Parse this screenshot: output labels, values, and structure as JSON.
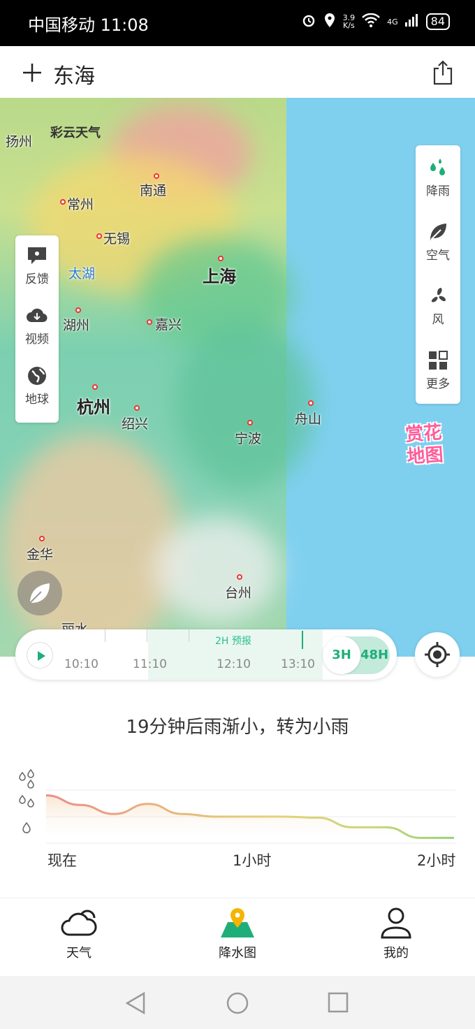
{
  "status_bar": {
    "carrier_time": "中国移动 11:08",
    "net_speed_value": "3.9",
    "net_speed_unit": "K/s",
    "network": "4G",
    "battery": "84"
  },
  "header": {
    "city": "东海"
  },
  "map": {
    "logo": "彩云天气",
    "cities": {
      "yangzhou": "扬州",
      "nantong": "南通",
      "changzhou": "常州",
      "wuxi": "无锡",
      "taihu": "太湖",
      "shanghai": "上海",
      "huzhou": "湖州",
      "jiaxing": "嘉兴",
      "hangzhou": "杭州",
      "shaoxing": "绍兴",
      "ningbo": "宁波",
      "zhoushan": "舟山",
      "jinhua": "金华",
      "taizhou": "台州",
      "lishui": "丽水"
    },
    "left_panel": {
      "feedback": "反馈",
      "video": "视频",
      "globe": "地球"
    },
    "right_panel": {
      "rain": "降雨",
      "air": "空气",
      "wind": "风",
      "more": "更多"
    },
    "flower_badge": {
      "line1": "赏花",
      "line2": "地图"
    }
  },
  "timeline": {
    "forecast_label": "2H 预报",
    "times": [
      "10:10",
      "11:10",
      "12:10",
      "13:10"
    ],
    "range_3h": "3H",
    "range_48h": "48H",
    "selected_range": "3H"
  },
  "summary": "19分钟后雨渐小，转为小雨",
  "chart_data": {
    "type": "area",
    "title": "",
    "x_labels": [
      "现在",
      "1小时",
      "2小时"
    ],
    "x_minutes": [
      0,
      10,
      20,
      30,
      40,
      50,
      60,
      70,
      80,
      90,
      100,
      110,
      120
    ],
    "series": [
      {
        "values": [
          0.9,
          0.72,
          0.55,
          0.74,
          0.55,
          0.5,
          0.5,
          0.5,
          0.48,
          0.3,
          0.3,
          0.1,
          0.1
        ]
      }
    ],
    "ylevels": [
      "小雨",
      "中雨",
      "大雨"
    ],
    "ylim": [
      0,
      1
    ],
    "grid": true,
    "colors": {
      "high": "#f08a8a",
      "mid": "#e4d27a",
      "low": "#9ad07a"
    }
  },
  "bottom_nav": {
    "weather": "天气",
    "precip_map": "降水图",
    "mine": "我的",
    "active": "precip_map"
  },
  "colors": {
    "accent": "#1fae7a",
    "sea": "#7fd0ef",
    "badge_pink": "#ff5d9a"
  }
}
